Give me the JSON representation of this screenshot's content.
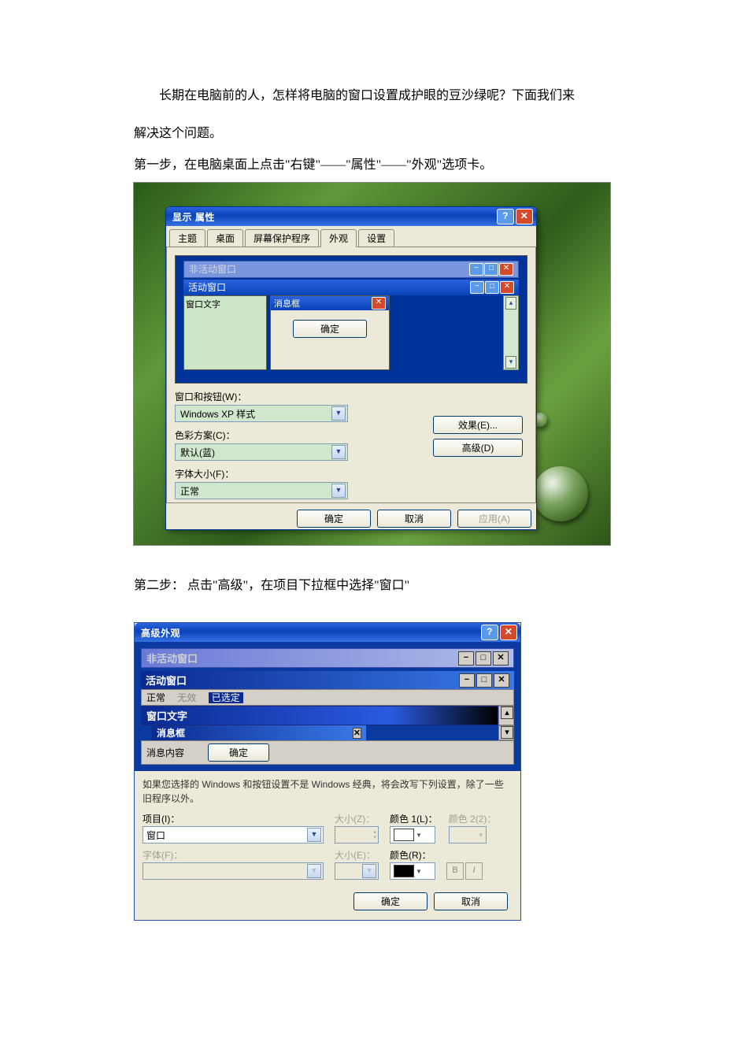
{
  "doc": {
    "intro_line1": "长期在电脑前的人，怎样将电脑的窗口设置成护眼的豆沙绿呢？下面我们来",
    "intro_line2": "解决这个问题。",
    "step1": "第一步，在电脑桌面上点击\"右键\"——\"属性\"——\"外观\"选项卡。",
    "step2": "第二步：  点击\"高级\"，在项目下拉框中选择\"窗口\""
  },
  "dlg1": {
    "title": "显示  属性",
    "tabs": {
      "theme": "主题",
      "desktop": "桌面",
      "screensaver": "屏幕保护程序",
      "appearance": "外观",
      "settings": "设置"
    },
    "preview": {
      "inactive": "非活动窗口",
      "active": "活动窗口",
      "wintext": "窗口文字",
      "msgbox": "消息框",
      "ok": "确定"
    },
    "labels": {
      "win_buttons": "窗口和按钮(W)：",
      "color_scheme": "色彩方案(C)：",
      "font_size": "字体大小(F)："
    },
    "values": {
      "win_buttons": "Windows XP 样式",
      "color_scheme": "默认(蓝)",
      "font_size": "正常"
    },
    "buttons": {
      "effects": "效果(E)...",
      "advanced": "高级(D)",
      "ok": "确定",
      "cancel": "取消",
      "apply": "应用(A)"
    }
  },
  "dlg2": {
    "title": "高级外观",
    "sample": {
      "inactive": "非活动窗口",
      "active": "活动窗口",
      "menu_normal": "正常",
      "menu_disabled": "无效",
      "menu_selected": "已选定",
      "wintext_title": "窗口文字",
      "msgbox": "消息框",
      "msg_content": "消息内容",
      "ok": "确定"
    },
    "hint": "如果您选择的 Windows 和按钮设置不是 Windows 经典，将会改写下列设置，除了一些旧程序以外。",
    "labels": {
      "item": "项目(I)：",
      "sizeZ": "大小(Z)：",
      "color1": "颜色 1(L)：",
      "color2": "颜色 2(2)：",
      "font": "字体(F)：",
      "sizeE": "大小(E)：",
      "colorR": "颜色(R)："
    },
    "values": {
      "item": "窗口",
      "sizeZ": "",
      "font": "",
      "sizeE": ""
    },
    "buttons": {
      "ok": "确定",
      "cancel": "取消",
      "B": "B",
      "I": "I"
    },
    "swatch": {
      "color1": "#ffffff",
      "colorR": "#000000"
    }
  },
  "glyphs": {
    "help": "?",
    "close": "✕",
    "min": "−",
    "max": "□",
    "down": "▾",
    "up": "▴",
    "dd": "▼"
  }
}
